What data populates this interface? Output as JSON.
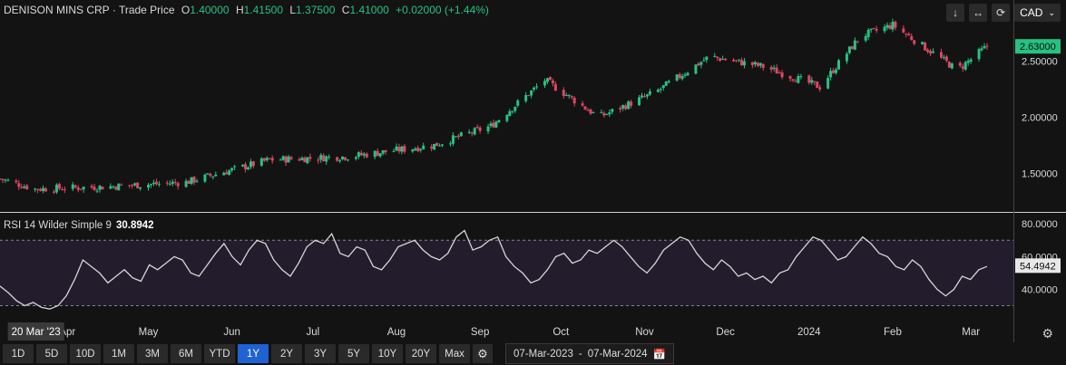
{
  "header": {
    "name": "DENISON MINS CRP",
    "sep": "·",
    "type": "Trade Price",
    "o_label": "O",
    "o": "1.40000",
    "h_label": "H",
    "h": "1.41500",
    "l_label": "L",
    "l": "1.37500",
    "c_label": "C",
    "c": "1.41000",
    "change": "+0.02000 (+1.44%)"
  },
  "toolbar": {
    "currency": "CAD"
  },
  "icons": {
    "down": "arrow-down-icon",
    "collapse": "collapse-icon",
    "refresh": "refresh-icon",
    "chevron": "chevron-down-icon",
    "gear": "gear-icon",
    "calendar": "calendar-icon"
  },
  "colors": {
    "up": "#26c281",
    "down": "#e0455f",
    "background": "#131313",
    "rsi_line": "#d6d6d6",
    "rsi_band": "#221c2c",
    "active_range": "#1f62d4"
  },
  "chart_data": {
    "type": "candlestick",
    "price_axis": {
      "ticks": [
        "2.50000",
        "2.00000",
        "1.50000"
      ],
      "tick_values": [
        2.5,
        2.0,
        1.5
      ],
      "range": [
        1.22,
        2.93
      ],
      "last_price_label": "2.63000",
      "last_price": 2.63
    },
    "x_axis": {
      "labels": [
        "Apr",
        "May",
        "Jun",
        "Jul",
        "Aug",
        "Sep",
        "Oct",
        "Nov",
        "Dec",
        "2024",
        "Feb",
        "Mar"
      ],
      "crosshair_date": "20 Mar '23"
    },
    "monthly_closes": [
      {
        "date": "2023-03-07",
        "close": 1.45
      },
      {
        "date": "2023-03-20",
        "close": 1.36
      },
      {
        "date": "2023-04-15",
        "close": 1.38
      },
      {
        "date": "2023-05-15",
        "close": 1.42
      },
      {
        "date": "2023-06-15",
        "close": 1.62
      },
      {
        "date": "2023-07-15",
        "close": 1.65
      },
      {
        "date": "2023-08-15",
        "close": 1.75
      },
      {
        "date": "2023-09-05",
        "close": 1.92
      },
      {
        "date": "2023-09-25",
        "close": 2.33
      },
      {
        "date": "2023-10-15",
        "close": 2.0
      },
      {
        "date": "2023-11-05",
        "close": 2.22
      },
      {
        "date": "2023-11-25",
        "close": 2.54
      },
      {
        "date": "2023-12-15",
        "close": 2.45
      },
      {
        "date": "2024-01-05",
        "close": 2.27
      },
      {
        "date": "2024-01-20",
        "close": 2.72
      },
      {
        "date": "2024-02-01",
        "close": 2.82
      },
      {
        "date": "2024-02-25",
        "close": 2.42
      },
      {
        "date": "2024-03-07",
        "close": 2.63
      }
    ],
    "rsi": {
      "label": "RSI 14 Wilder Simple 9",
      "value_label": "30.8942",
      "ticks": [
        "80.0000",
        "60.0000",
        "40.0000"
      ],
      "tick_values": [
        80,
        60,
        40
      ],
      "range": [
        22,
        84
      ],
      "band": [
        30,
        70
      ],
      "last_label": "54.4942",
      "last": 54.49,
      "series": [
        42,
        38,
        33,
        30,
        32,
        29,
        28,
        30,
        36,
        46,
        58,
        54,
        50,
        44,
        48,
        52,
        47,
        45,
        55,
        52,
        56,
        60,
        58,
        50,
        48,
        55,
        62,
        68,
        60,
        55,
        64,
        70,
        68,
        58,
        52,
        48,
        56,
        66,
        70,
        68,
        74,
        62,
        60,
        66,
        64,
        54,
        52,
        58,
        66,
        68,
        70,
        64,
        60,
        58,
        62,
        72,
        76,
        64,
        66,
        70,
        72,
        60,
        54,
        50,
        44,
        46,
        52,
        60,
        62,
        56,
        58,
        64,
        62,
        66,
        70,
        66,
        60,
        54,
        50,
        56,
        64,
        68,
        72,
        70,
        62,
        56,
        52,
        58,
        54,
        48,
        50,
        46,
        48,
        44,
        50,
        52,
        60,
        66,
        72,
        70,
        64,
        58,
        60,
        66,
        72,
        68,
        62,
        60,
        54,
        52,
        58,
        54,
        46,
        40,
        36,
        40,
        48,
        46,
        52,
        54
      ]
    }
  },
  "ranges": [
    "1D",
    "5D",
    "10D",
    "1M",
    "3M",
    "6M",
    "YTD",
    "1Y",
    "2Y",
    "3Y",
    "5Y",
    "10Y",
    "20Y",
    "Max"
  ],
  "active_range": "1Y",
  "date_range": {
    "from": "07-Mar-2023",
    "sep": "-",
    "to": "07-Mar-2024"
  }
}
